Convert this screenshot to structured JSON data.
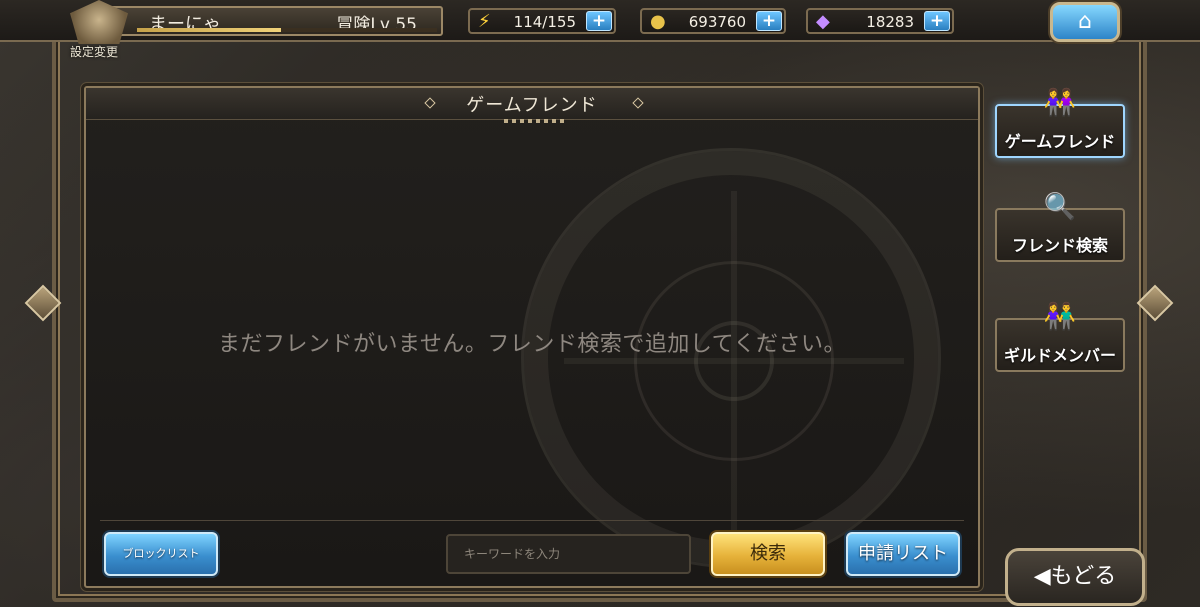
{
  "player": {
    "name": "まーにゃ",
    "level_label": "冒険Lv 55",
    "settings_label": "設定変更",
    "exp_progress": 0.48
  },
  "resources": {
    "stamina": "114/155",
    "gold": "693760",
    "gems": "18283"
  },
  "panel": {
    "title": "ゲームフレンド",
    "empty_message": "まだフレンドがいません。フレンド検索で追加してください。"
  },
  "footer": {
    "block_list_label": "ブロックリスト",
    "keyword_placeholder": "キーワードを入力",
    "search_label": "検索",
    "request_list_label": "申請リスト"
  },
  "side_tabs": [
    {
      "label": "ゲームフレンド",
      "active": true
    },
    {
      "label": "フレンド検索",
      "active": false
    },
    {
      "label": "ギルドメンバー",
      "active": false
    }
  ],
  "back_label": "もどる",
  "colors": {
    "accent_blue": "#3a8fcf",
    "accent_gold": "#e6b23a",
    "frame": "#8c7a5c"
  }
}
